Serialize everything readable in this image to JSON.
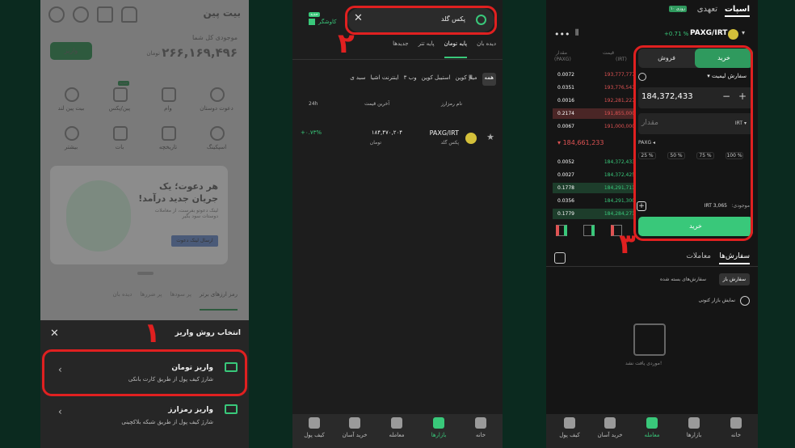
{
  "panel1": {
    "brand": "بیت پین",
    "balance_label": "موجودی کل شما",
    "balance": "۲۶۶,۱۶۹,۴۹۶",
    "balance_unit": "تومان",
    "deposit_btn": "واریز",
    "shortcuts": [
      "دعوت دوستان",
      "وام",
      "پین/پکس",
      "بیت پین لند",
      "اسپکینگ",
      "تاریخچه",
      "بات",
      "بیشتر"
    ],
    "new_badge": "جدید",
    "banner_title": "هر دعوت؛ یک جریان جدید درآمد!",
    "banner_text": "لینک دعوتو بفرست، از معاملات دوستات سود بگیر",
    "banner_btn": "ارسال لینک دعوت",
    "market_tabs": [
      "رمز ارزهای برتر",
      "پر سودها",
      "پر ضررها",
      "دیده بان"
    ],
    "sheet_title": "انتخاب روش واریز",
    "opt1_title": "واریز تومان",
    "opt1_sub": "شارژ کیف پول از طریق کارت بانکی",
    "opt2_title": "واریز رمزارز",
    "opt2_sub": "شارژ کیف پول از طریق شبکه بلاکچینی",
    "step": "۱"
  },
  "panel2": {
    "search_value": "پکس گلد",
    "cashback": "کاوشگر",
    "cashback_badge": "جدید",
    "tabs": [
      "دیده بان",
      "پایه تومان",
      "پایه تتر",
      "جدیدها"
    ],
    "chips": [
      "همه",
      "میم کوین",
      "استیبل کوین",
      "وب ۳",
      "اینترنت اشیا",
      "سبد ی"
    ],
    "col_name": "نام رمزارز",
    "col_price": "آخرین قیمت",
    "col_24h": "24h",
    "row_symbol": "PAXG/IRT",
    "row_name": "پکس گلد",
    "row_price": "۱۸۴,۴۷۰,۲۰۴",
    "row_price_unit": "تومان",
    "row_change": "+۰.۷۳%",
    "nav": [
      "خانه",
      "بازارها",
      "معامله",
      "خرید آسان",
      "کیف پول"
    ],
    "step": "۲"
  },
  "panel3": {
    "tab_spot": "اسپات",
    "tab_margin": "تعهدی",
    "margin_badge": "۱۰ روزی",
    "pair": "PAXG/IRT",
    "pair_change": "+0.71 %",
    "col_price": "قیمت",
    "col_price_unit": "(IRT)",
    "col_amount": "مقدار",
    "col_amount_unit": "(PAXG)",
    "asks": [
      [
        "193,777,777",
        "0.0072"
      ],
      [
        "193,776,543",
        "0.0351"
      ],
      [
        "192,281,227",
        "0.0016"
      ],
      [
        "191,855,000",
        "0.2174"
      ],
      [
        "191,000,000",
        "0.0067"
      ]
    ],
    "mid_price": "184,661,233",
    "bids": [
      [
        "184,372,433",
        "0.0052"
      ],
      [
        "184,372,425",
        "0.0027"
      ],
      [
        "184,291,711",
        "0.1778"
      ],
      [
        "184,291,300",
        "0.0356"
      ],
      [
        "184,284,271",
        "0.1779"
      ]
    ],
    "buy_tab": "خرید",
    "sell_tab": "فروش",
    "order_type": "سفارش لیمیت",
    "price_value": "184,372,433",
    "amount_placeholder": "مقدار",
    "price_unit": "IRT",
    "asset": "PAXG",
    "percents": [
      "25 %",
      "50 %",
      "75 %",
      "100 %"
    ],
    "balance_label": "موجودی:",
    "balance_value": "IRT 3,065",
    "buy_btn": "خرید",
    "orders_tabs": [
      "سفارش‌ها",
      "معاملات"
    ],
    "filter_open": "سفارش باز",
    "filter_closed": "سفارش‌های بسته شده",
    "show_current": "نمایش بازار کنونی",
    "empty": "موردی یافت نشد!",
    "nav": [
      "خانه",
      "بازارها",
      "معامله",
      "خرید آسان",
      "کیف پول"
    ],
    "step": "۳"
  }
}
